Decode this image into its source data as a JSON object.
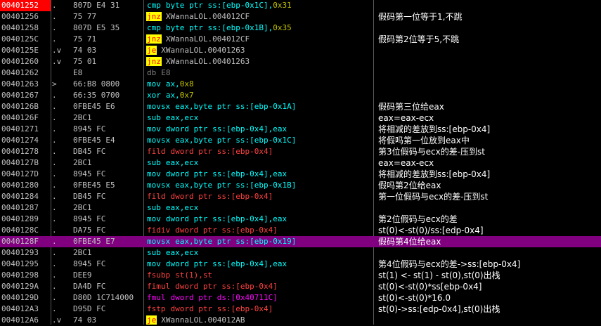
{
  "colors": {
    "background": "#000000",
    "address_normal": "#c0c0c0",
    "address_eip_bg": "#ff0000",
    "selection_bg": "#800080",
    "mnemonic_cyan": "#00ffff",
    "mnemonic_jump_bg": "#ffff00",
    "mnemonic_fpu": "#ff4040",
    "mnemonic_fpu_alt": "#ff00ff",
    "mnemonic_db": "#808080",
    "number_yellow": "#c0c000",
    "comment": "#ffffff"
  },
  "rows": [
    {
      "addr": "00401252",
      "mark": ".",
      "hex": "807D E4 31",
      "mn": "cmp",
      "ops": "byte ptr ss:[ebp-0x1C],",
      "num": "0x31",
      "kind": "cyan",
      "comment": "",
      "eip": true,
      "sel": false
    },
    {
      "addr": "00401256",
      "mark": ".",
      "hex": "75 77",
      "mn": "jnz",
      "ops": "XWannaLOL.004012CF",
      "num": "",
      "kind": "jump",
      "comment": "假码第一位等于1,不跳",
      "eip": false,
      "sel": false
    },
    {
      "addr": "00401258",
      "mark": ".",
      "hex": "807D E5 35",
      "mn": "cmp",
      "ops": "byte ptr ss:[ebp-0x1B],",
      "num": "0x35",
      "kind": "cyan",
      "comment": "",
      "eip": false,
      "sel": false
    },
    {
      "addr": "0040125C",
      "mark": ".",
      "hex": "75 71",
      "mn": "jnz",
      "ops": "XWannaLOL.004012CF",
      "num": "",
      "kind": "jump",
      "comment": "假码第2位等于5,不跳",
      "eip": false,
      "sel": false
    },
    {
      "addr": "0040125E",
      "mark": ".v",
      "hex": "74 03",
      "mn": "je",
      "ops": "XWannaLOL.00401263",
      "num": "",
      "kind": "jump",
      "comment": "",
      "eip": false,
      "sel": false
    },
    {
      "addr": "00401260",
      "mark": ".v",
      "hex": "75 01",
      "mn": "jnz",
      "ops": "XWannaLOL.00401263",
      "num": "",
      "kind": "jump",
      "comment": "",
      "eip": false,
      "sel": false
    },
    {
      "addr": "00401262",
      "mark": "",
      "hex": "E8",
      "mn": "db",
      "ops": "E8",
      "num": "",
      "kind": "db",
      "comment": "",
      "eip": false,
      "sel": false
    },
    {
      "addr": "00401263",
      "mark": ">",
      "hex": "66:B8 0800",
      "mn": "mov",
      "ops": "ax,",
      "num": "0x8",
      "kind": "cyan",
      "comment": "",
      "eip": false,
      "sel": false
    },
    {
      "addr": "00401267",
      "mark": ".",
      "hex": "66:35 0700",
      "mn": "xor",
      "ops": "ax,",
      "num": "0x7",
      "kind": "cyan",
      "comment": "",
      "eip": false,
      "sel": false
    },
    {
      "addr": "0040126B",
      "mark": ".",
      "hex": "0FBE45 E6",
      "mn": "movsx",
      "ops": "eax,byte ptr ss:[ebp-0x1A]",
      "num": "",
      "kind": "cyan",
      "comment": "假码第三位给eax",
      "eip": false,
      "sel": false
    },
    {
      "addr": "0040126F",
      "mark": ".",
      "hex": "2BC1",
      "mn": "sub",
      "ops": "eax,ecx",
      "num": "",
      "kind": "cyan",
      "comment": "eax=eax-ecx",
      "eip": false,
      "sel": false
    },
    {
      "addr": "00401271",
      "mark": ".",
      "hex": "8945 FC",
      "mn": "mov",
      "ops": "dword ptr ss:[ebp-0x4],eax",
      "num": "",
      "kind": "cyan",
      "comment": "将相减的差放到ss:[ebp-0x4]",
      "eip": false,
      "sel": false
    },
    {
      "addr": "00401274",
      "mark": ".",
      "hex": "0FBE45 E4",
      "mn": "movsx",
      "ops": "eax,byte ptr ss:[ebp-0x1C]",
      "num": "",
      "kind": "cyan",
      "comment": "将假吗第一位放到eax中",
      "eip": false,
      "sel": false
    },
    {
      "addr": "00401278",
      "mark": ".",
      "hex": "DB45 FC",
      "mn": "fild",
      "ops": "dword ptr ss:[ebp-0x4]",
      "num": "",
      "kind": "fpu",
      "comment": "第3位假码与ecx的差-压到st",
      "eip": false,
      "sel": false
    },
    {
      "addr": "0040127B",
      "mark": ".",
      "hex": "2BC1",
      "mn": "sub",
      "ops": "eax,ecx",
      "num": "",
      "kind": "cyan",
      "comment": "eax=eax-ecx",
      "eip": false,
      "sel": false
    },
    {
      "addr": "0040127D",
      "mark": ".",
      "hex": "8945 FC",
      "mn": "mov",
      "ops": "dword ptr ss:[ebp-0x4],eax",
      "num": "",
      "kind": "cyan",
      "comment": "将相减的差放到ss:[ebp-0x4]",
      "eip": false,
      "sel": false
    },
    {
      "addr": "00401280",
      "mark": ".",
      "hex": "0FBE45 E5",
      "mn": "movsx",
      "ops": "eax,byte ptr ss:[ebp-0x1B]",
      "num": "",
      "kind": "cyan",
      "comment": "假吗第2位给eax",
      "eip": false,
      "sel": false
    },
    {
      "addr": "00401284",
      "mark": ".",
      "hex": "DB45 FC",
      "mn": "fild",
      "ops": "dword ptr ss:[ebp-0x4]",
      "num": "",
      "kind": "fpu",
      "comment": "第一位假码与ecx的差-压到st",
      "eip": false,
      "sel": false
    },
    {
      "addr": "00401287",
      "mark": ".",
      "hex": "2BC1",
      "mn": "sub",
      "ops": "eax,ecx",
      "num": "",
      "kind": "cyan",
      "comment": "",
      "eip": false,
      "sel": false
    },
    {
      "addr": "00401289",
      "mark": ".",
      "hex": "8945 FC",
      "mn": "mov",
      "ops": "dword ptr ss:[ebp-0x4],eax",
      "num": "",
      "kind": "cyan",
      "comment": "第2位假码与ecx的差",
      "eip": false,
      "sel": false
    },
    {
      "addr": "0040128C",
      "mark": ".",
      "hex": "DA75 FC",
      "mn": "fidiv",
      "ops": "dword ptr ss:[ebp-0x4]",
      "num": "",
      "kind": "fpu",
      "comment": "st(0)<-st(0)/ss:[edp-0x4]",
      "eip": false,
      "sel": false
    },
    {
      "addr": "0040128F",
      "mark": ".",
      "hex": "0FBE45 E7",
      "mn": "movsx",
      "ops": "eax,byte ptr ss:[ebp-0x19]",
      "num": "",
      "kind": "cyan",
      "comment": "假码第4位给eax",
      "eip": false,
      "sel": true
    },
    {
      "addr": "00401293",
      "mark": ".",
      "hex": "2BC1",
      "mn": "sub",
      "ops": "eax,ecx",
      "num": "",
      "kind": "cyan",
      "comment": "",
      "eip": false,
      "sel": false
    },
    {
      "addr": "00401295",
      "mark": ".",
      "hex": "8945 FC",
      "mn": "mov",
      "ops": "dword ptr ss:[ebp-0x4],eax",
      "num": "",
      "kind": "cyan",
      "comment": "第4位假码与ecx的差->ss:[ebp-0x4]",
      "eip": false,
      "sel": false
    },
    {
      "addr": "00401298",
      "mark": ".",
      "hex": "DEE9",
      "mn": "fsubp",
      "ops": "st(1),st",
      "num": "",
      "kind": "fpu",
      "comment": "st(1) <- st(1) - st(0),st(0)出栈",
      "eip": false,
      "sel": false
    },
    {
      "addr": "0040129A",
      "mark": ".",
      "hex": "DA4D FC",
      "mn": "fimul",
      "ops": "dword ptr ss:[ebp-0x4]",
      "num": "",
      "kind": "fpu",
      "comment": "st(0)<-st(0)*ss[ebp-0x4]",
      "eip": false,
      "sel": false
    },
    {
      "addr": "0040129D",
      "mark": ".",
      "hex": "D80D 1C714000",
      "mn": "fmul",
      "ops": "dword ptr ds:[0x40711C]",
      "num": "",
      "kind": "fpu2",
      "comment": "st(0)<-st(0)*16.0",
      "eip": false,
      "sel": false
    },
    {
      "addr": "004012A3",
      "mark": ".",
      "hex": "D95D FC",
      "mn": "fstp",
      "ops": "dword ptr ss:[ebp-0x4]",
      "num": "",
      "kind": "fpu",
      "comment": "st(0)->ss:[edp-0x4],st(0)出栈",
      "eip": false,
      "sel": false
    },
    {
      "addr": "004012A6",
      "mark": ".v",
      "hex": "74 03",
      "mn": "je",
      "ops": "XWannaLOL.004012AB",
      "num": "",
      "kind": "jump",
      "comment": "",
      "eip": false,
      "sel": false
    }
  ]
}
